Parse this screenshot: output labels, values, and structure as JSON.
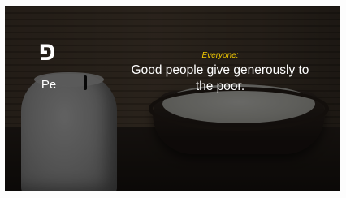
{
  "slide": {
    "letter": "פ",
    "letter_name": "Pe",
    "speaker": "Everyone:",
    "verse": "Good people give generously to the poor."
  },
  "colors": {
    "speaker_accent": "#f0c800",
    "text": "#ffffff"
  }
}
